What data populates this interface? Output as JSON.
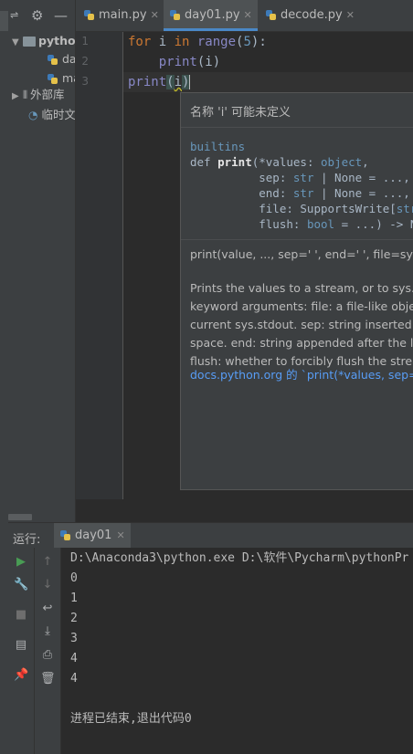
{
  "project": {
    "root_label": "pytho",
    "files": [
      "da",
      "ma"
    ],
    "external_libs_label": "外部库",
    "scratches_label": "临时文"
  },
  "editor": {
    "tabs": [
      {
        "label": "main.py",
        "active": false
      },
      {
        "label": "day01.py",
        "active": true
      },
      {
        "label": "decode.py",
        "active": false
      }
    ],
    "line_numbers": [
      "1",
      "2",
      "3"
    ],
    "code": {
      "line1": {
        "kw1": "for",
        "var": " i ",
        "kw2": "in",
        "fn": " range",
        "open": "(",
        "num": "5",
        "close": "):"
      },
      "line2": {
        "indent": "    ",
        "fn": "print",
        "args": "(i)"
      },
      "line3": {
        "fn": "print",
        "open": "(",
        "arg": "i",
        "close": ")"
      }
    }
  },
  "popup": {
    "title": "名称 'i' 可能未定义",
    "module": "builtins",
    "sig": {
      "l1_a": "def ",
      "l1_name": "print",
      "l1_b": "(*values: ",
      "l1_type": "object",
      "l1_c": ",",
      "l2_a": "          sep: ",
      "l2_type": "str",
      "l2_b": " | None = ...,",
      "l3_a": "          end: ",
      "l3_type": "str",
      "l3_b": " | None = ...,",
      "l4_a": "          file: SupportsWrite[",
      "l4_type": "str",
      "l4_b": "]",
      "l5_a": "          flush: ",
      "l5_type": "bool",
      "l5_b": " = ...) -> Non"
    },
    "short_sig": "print(value, ..., sep=' ', end=' ', file=sys.st",
    "doc_lines": [
      "Prints the values to a stream, or to sys.st",
      "keyword arguments: file: a file-like objec",
      "current sys.stdout. sep: string inserted b",
      "space. end: string appended after the las",
      "flush: whether to forcibly flush the strea"
    ],
    "link": "docs.python.org 的 `print(*values, sep=..."
  },
  "run": {
    "label": "运行:",
    "tab": "day01",
    "output": [
      "D:\\Anaconda3\\python.exe D:\\软件\\Pycharm\\pythonPr",
      "0",
      "1",
      "2",
      "3",
      "4",
      "4",
      "",
      "进程已结束,退出代码0"
    ]
  },
  "icons": {
    "tab_icon": "python-file-icon",
    "run_controls": [
      "rerun-icon",
      "wrench-icon",
      "stop-icon",
      "layout-icon",
      "pin-icon"
    ],
    "console_controls": [
      "up-arrow-icon",
      "down-arrow-icon",
      "soft-wrap-icon",
      "scroll-to-end-icon",
      "print-icon",
      "trash-icon"
    ]
  },
  "colors": {
    "keyword": "#cc7832",
    "builtin": "#8888c6",
    "number": "#6897bb",
    "link": "#589df6",
    "run_green": "#499c54"
  }
}
